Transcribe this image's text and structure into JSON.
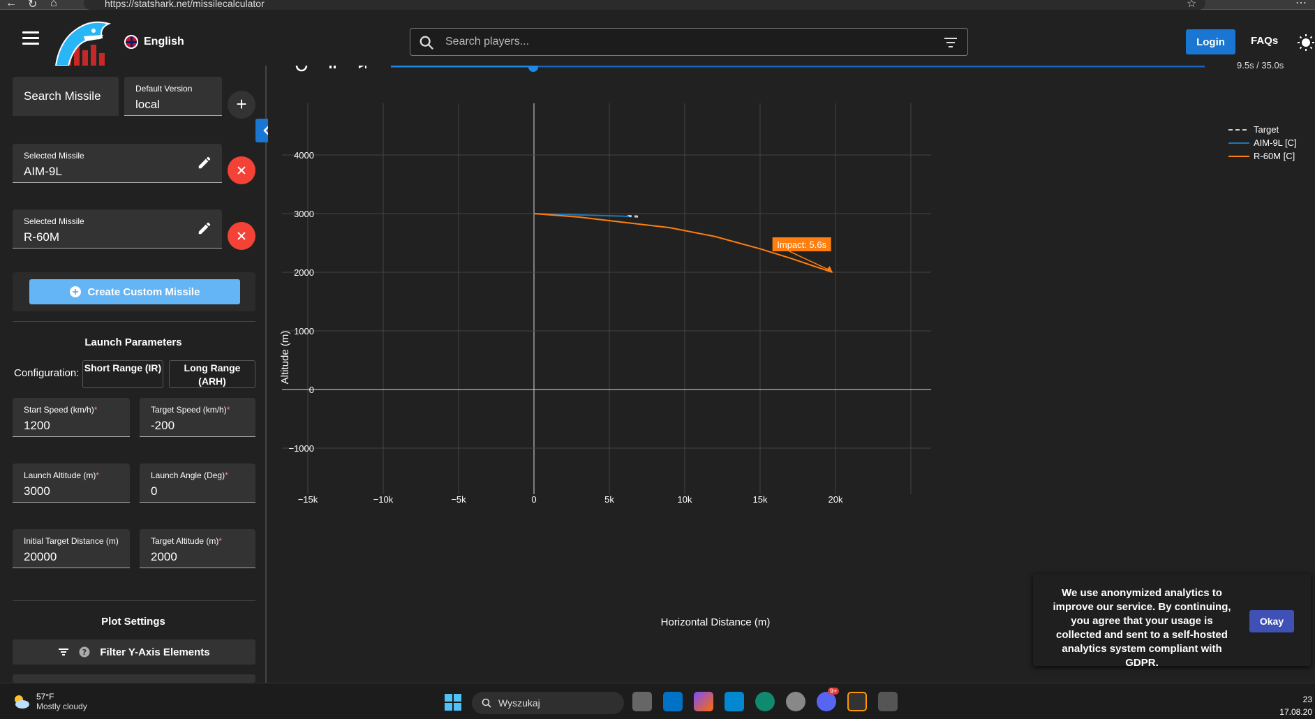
{
  "browser": {
    "url": "https://statshark.net/missilecalculator"
  },
  "header": {
    "language": "English",
    "search_placeholder": "Search players...",
    "login_label": "Login",
    "faqs_label": "FAQs"
  },
  "sidebar": {
    "search_missile_label": "Search Missile",
    "default_version_label": "Default Version",
    "default_version_value": "local",
    "plus_label": "+",
    "missiles": [
      {
        "label": "Selected Missile",
        "value": "AIM-9L"
      },
      {
        "label": "Selected Missile",
        "value": "R-60M"
      }
    ],
    "create_custom_label": "Create Custom Missile",
    "launch_params_title": "Launch Parameters",
    "configuration_label": "Configuration:",
    "config_short": "Short Range (IR)",
    "config_long": "Long Range (ARH)",
    "fields": {
      "start_speed": {
        "label": "Start Speed (km/h)",
        "value": "1200"
      },
      "target_speed": {
        "label": "Target Speed (km/h)",
        "value": "-200"
      },
      "launch_altitude": {
        "label": "Launch Altitude (m)",
        "value": "3000"
      },
      "launch_angle": {
        "label": "Launch Angle (Deg)",
        "value": "0"
      },
      "initial_target_distance": {
        "label": "Initial Target Distance (m)",
        "value": "20000"
      },
      "target_altitude": {
        "label": "Target Altitude (m)",
        "value": "2000"
      }
    },
    "required_mark": "*",
    "plot_settings_title": "Plot Settings",
    "filter_y_label": "Filter Y-Axis Elements"
  },
  "animation": {
    "time_readout": "9.5s / 35.0s"
  },
  "chart_data": {
    "type": "line",
    "xlabel": "Horizontal Distance (m)",
    "ylabel": "Altitude (m)",
    "xlim": [
      -18000,
      26000
    ],
    "ylim": [
      -1400,
      4900
    ],
    "x_ticks": [
      -15000,
      -10000,
      -5000,
      0,
      5000,
      10000,
      15000,
      20000
    ],
    "x_tick_labels": [
      "−15k",
      "−10k",
      "−5k",
      "0",
      "5k",
      "10k",
      "15k",
      "20k"
    ],
    "y_ticks": [
      -1000,
      0,
      1000,
      2000,
      3000,
      4000
    ],
    "y_tick_labels": [
      "−1000",
      "0",
      "1000",
      "2000",
      "3000",
      "4000"
    ],
    "grid": true,
    "legend_position": "top-right",
    "series": [
      {
        "name": "Target",
        "style": "dashed",
        "color": "#cccccc",
        "x": [
          6200,
          6900
        ],
        "y": [
          2960,
          2950
        ]
      },
      {
        "name": "AIM-9L [C]",
        "style": "solid",
        "color": "#1f77b4",
        "x": [
          0,
          2000,
          4000,
          6000,
          6300
        ],
        "y": [
          3000,
          2985,
          2970,
          2955,
          2950
        ]
      },
      {
        "name": "R-60M [C]",
        "style": "solid",
        "color": "#ff7f0e",
        "x": [
          0,
          3000,
          6000,
          9000,
          12000,
          15000,
          17000,
          18500,
          19800
        ],
        "y": [
          3000,
          2940,
          2850,
          2760,
          2610,
          2400,
          2240,
          2110,
          2000
        ]
      }
    ],
    "annotations": [
      {
        "text": "Impact: 5.6s",
        "x": 19800,
        "y": 2000,
        "color": "#ff7f0e"
      }
    ]
  },
  "cookie": {
    "text": "We use anonymized analytics to improve our service. By continuing, you agree that your usage is collected and sent to a self-hosted analytics system compliant with GDPR.",
    "okay_label": "Okay"
  },
  "taskbar": {
    "temperature": "57°F",
    "weather": "Mostly cloudy",
    "search_label": "Wyszukaj",
    "clock_time": "23",
    "clock_date": "17.08.20",
    "badge": "9+"
  }
}
